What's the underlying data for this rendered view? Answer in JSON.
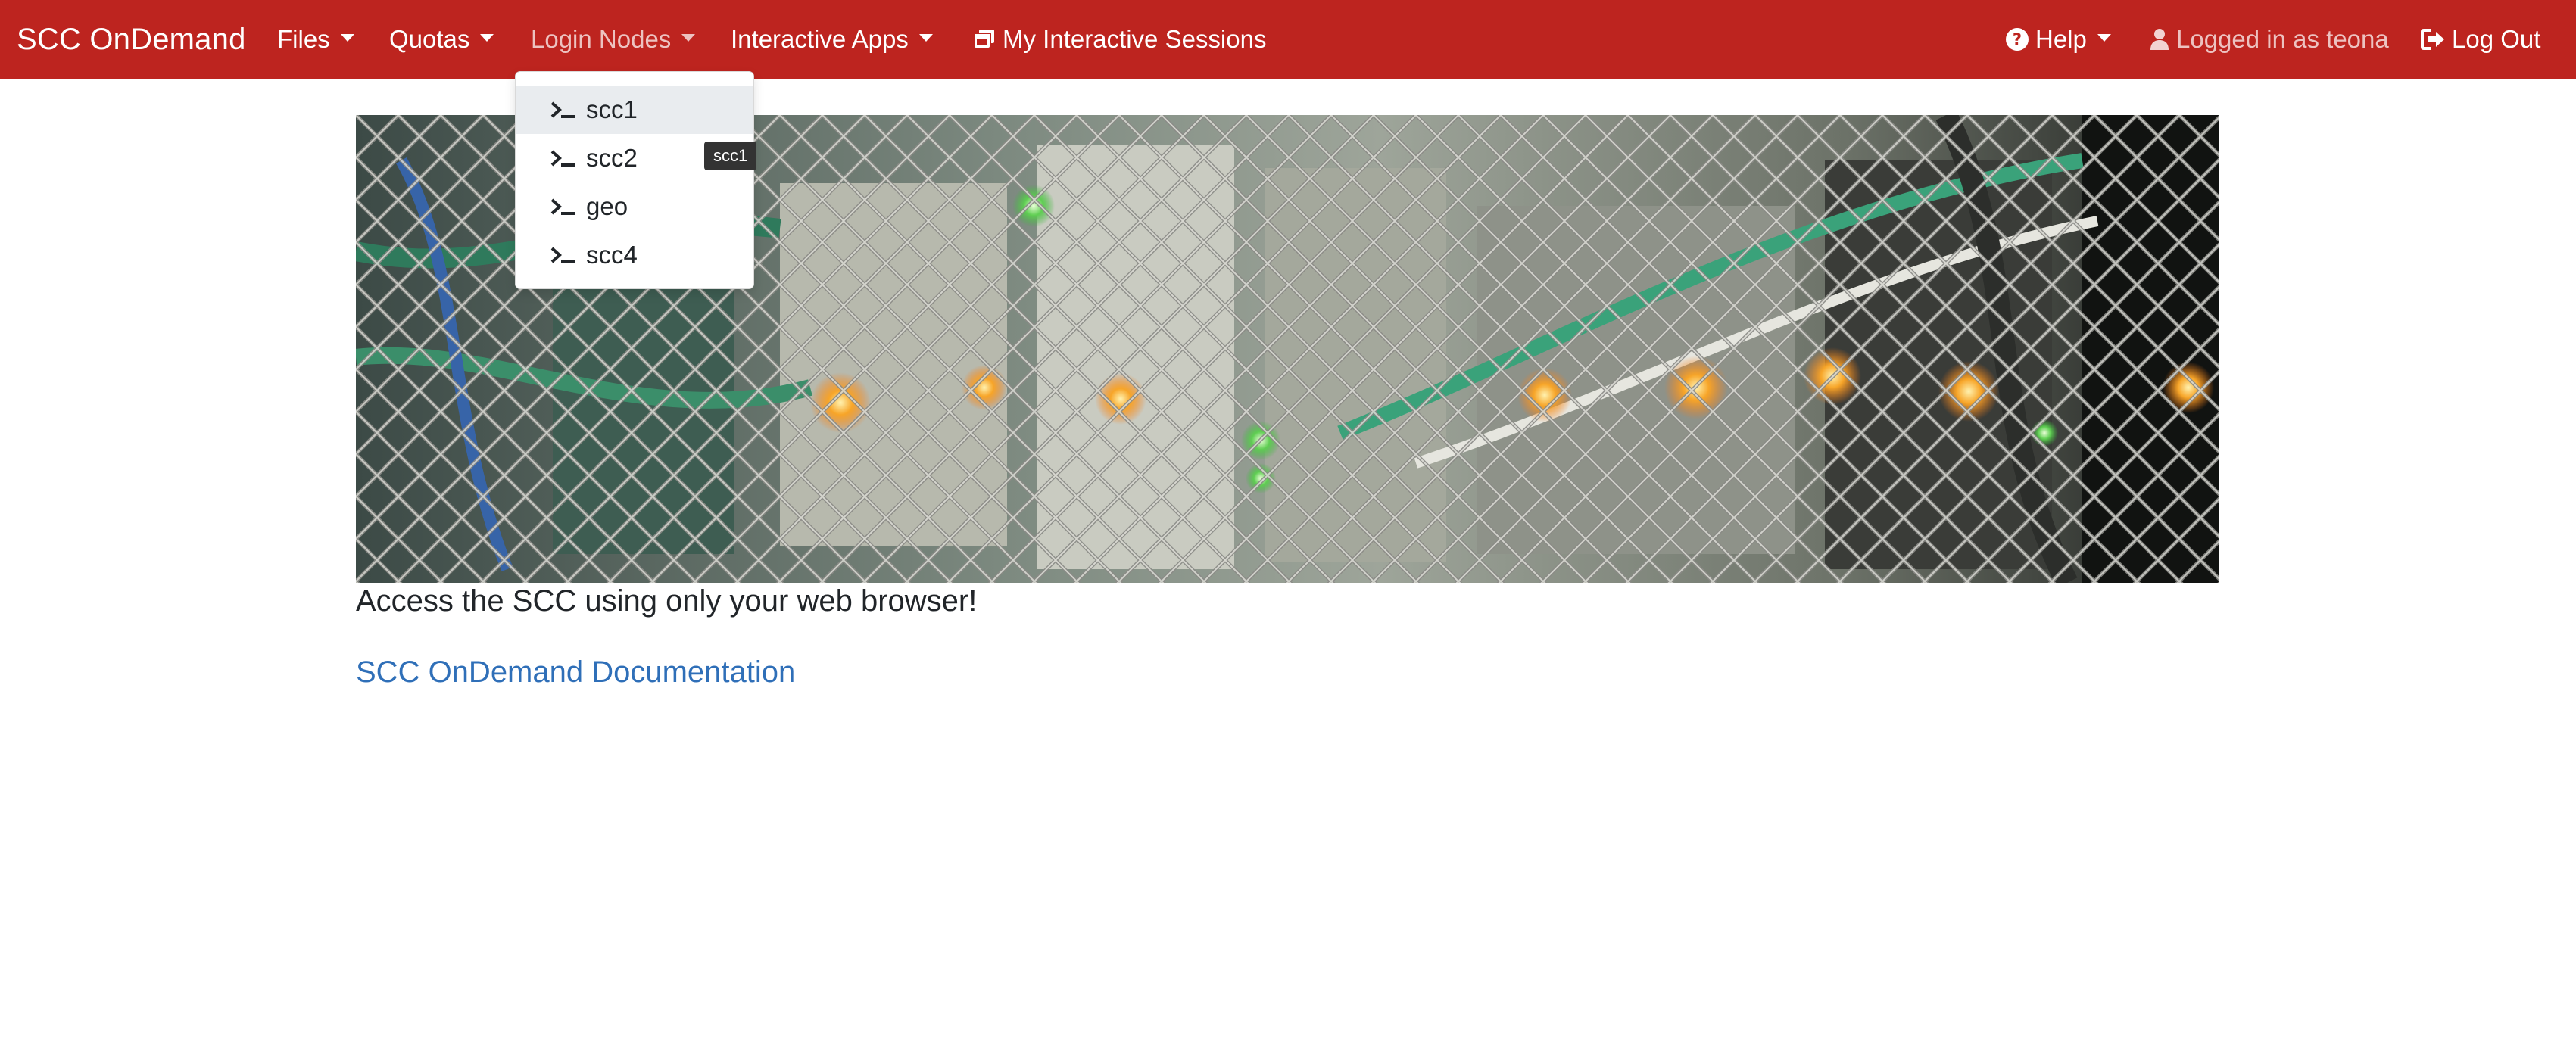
{
  "navbar": {
    "brand": "SCC OnDemand",
    "files": "Files",
    "quotas": "Quotas",
    "login_nodes": "Login Nodes",
    "interactive_apps": "Interactive Apps",
    "sessions": "My Interactive Sessions",
    "help": "Help",
    "user": "Logged in as teona",
    "logout": "Log Out",
    "accent_color": "#bd241f"
  },
  "login_nodes_menu": {
    "items": [
      {
        "label": "scc1",
        "icon": "terminal-icon",
        "highlighted": true
      },
      {
        "label": "scc2",
        "icon": "terminal-icon"
      },
      {
        "label": "geo",
        "icon": "terminal-icon"
      },
      {
        "label": "scc4",
        "icon": "terminal-icon"
      }
    ],
    "tooltip": "scc1"
  },
  "main": {
    "tagline": "Access the SCC using only your web browser!",
    "doc_link": "SCC OnDemand Documentation",
    "link_color": "#2f6fb8"
  }
}
